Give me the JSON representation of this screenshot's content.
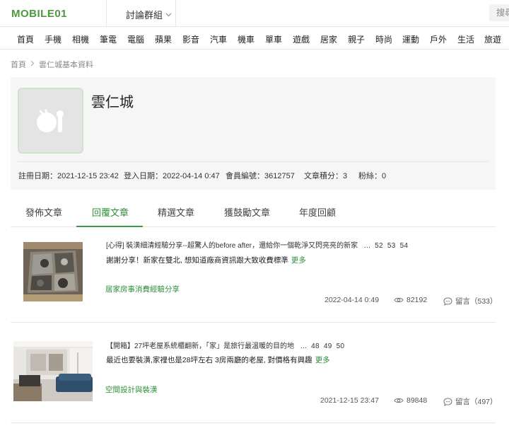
{
  "header": {
    "logo_text": "MOBILE01",
    "forum_group_label": "討論群組",
    "search_placeholder": "搜尋"
  },
  "nav": {
    "categories": [
      "首頁",
      "手機",
      "相機",
      "筆電",
      "電腦",
      "蘋果",
      "影音",
      "汽車",
      "機車",
      "單車",
      "遊戲",
      "居家",
      "親子",
      "時尚",
      "運動",
      "戶外",
      "生活",
      "旅遊"
    ]
  },
  "breadcrumb": {
    "home": "首頁",
    "current": "雲仁城基本資料"
  },
  "profile": {
    "username": "雲仁城",
    "register_date": "註冊日期：2021-12-15 23:42",
    "login_date": "登入日期：2022-04-14 0:47",
    "member_no": "會員編號：3612757",
    "post_score": "文章積分：3",
    "fans": "粉絲：0"
  },
  "tabs": [
    "發佈文章",
    "回覆文章",
    "精選文章",
    "獲鼓勵文章",
    "年度回顧"
  ],
  "active_tab_index": 1,
  "colors": {
    "brand_green": "#2f8f3a",
    "logo_green": "#4a9a3c"
  },
  "posts": [
    {
      "title": "[心得] 裝潢細清經驗分享--超驚人的before after，還給你一個乾淨又閃亮亮的新家",
      "ellipsis": "...",
      "pages": [
        "52",
        "53",
        "54"
      ],
      "snippet": "謝謝分享！新家在雙北, 想知道廠商資訊跟大致收費標準",
      "more": "更多",
      "category": "居家房事消費經驗分享",
      "date": "2022-04-14 0:49",
      "views": "82192",
      "comments": "留言（533）"
    },
    {
      "title": "【開箱】27坪老屋系統櫃翻新，「家」是旅行最溫暖的目的地",
      "ellipsis": "...",
      "pages": [
        "48",
        "49",
        "50"
      ],
      "snippet": "最近也要裝潢,家裡也是28坪左右 3房兩廳的老屋, 對價格有興趣",
      "more": "更多",
      "category": "空間設計與裝潢",
      "date": "2021-12-15 23:47",
      "views": "89848",
      "comments": "留言（497）"
    }
  ]
}
